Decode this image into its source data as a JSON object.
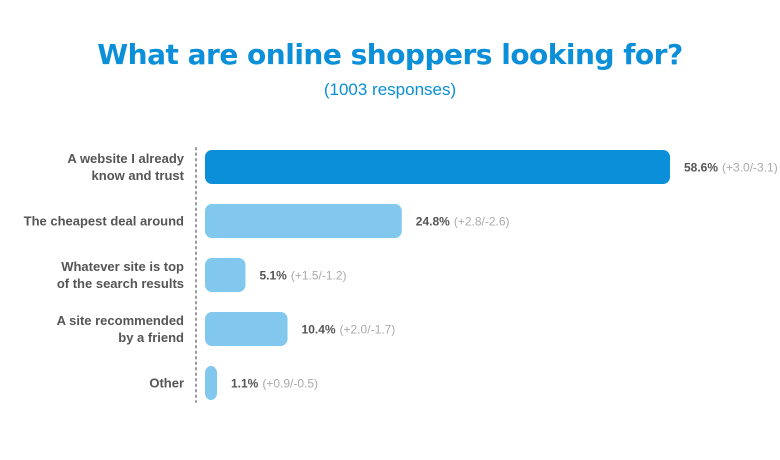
{
  "chart_data": {
    "type": "bar",
    "orientation": "horizontal",
    "title": "What are online shoppers looking for?",
    "subtitle": "(1003 responses)",
    "categories": [
      [
        "A website I already",
        "know and trust"
      ],
      [
        "The cheapest deal around"
      ],
      [
        "Whatever site is top",
        "of the search results"
      ],
      [
        "A site recommended",
        "by a friend"
      ],
      [
        "Other"
      ]
    ],
    "values": [
      58.6,
      24.8,
      5.1,
      10.4,
      1.1
    ],
    "value_labels": [
      "58.6%",
      "24.8%",
      "5.1%",
      "10.4%",
      "1.1%"
    ],
    "error_labels": [
      "(+3.0/-3.1)",
      "(+2.8/-2.6)",
      "(+1.5/-1.2)",
      "(+2.0/-1.7)",
      "(+0.9/-0.5)"
    ],
    "xlim": [
      0,
      58.6
    ],
    "grid": false,
    "legend": "none",
    "colors": {
      "highlight": "#0a8fd8",
      "bar": "#82c8ee",
      "title": "#0a8fd8",
      "axis_dots": "#999999"
    }
  }
}
